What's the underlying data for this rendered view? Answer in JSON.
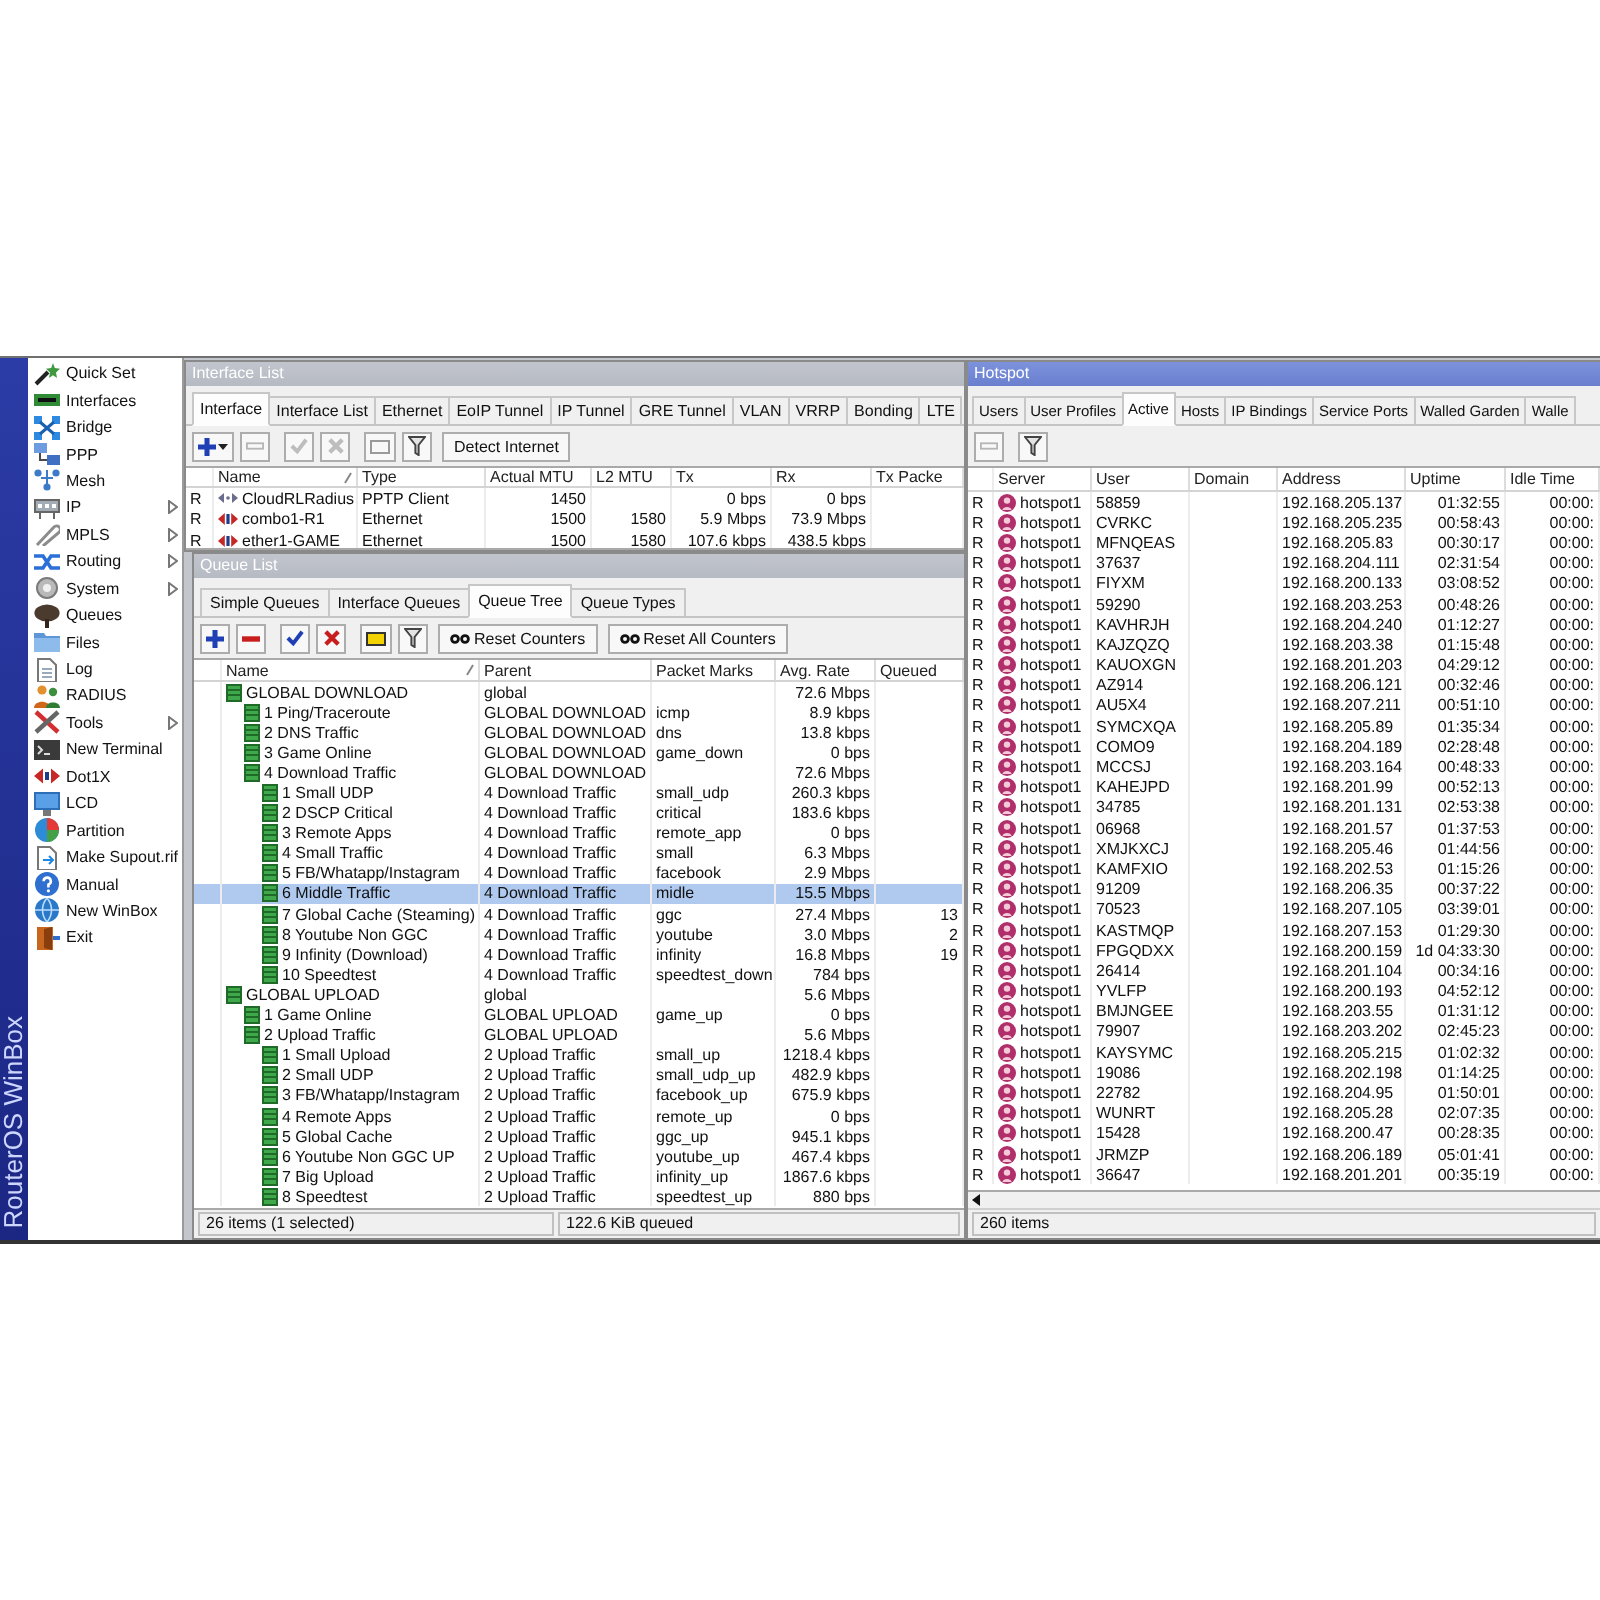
{
  "sidebar": {
    "brand": "RouterOS WinBox",
    "items": [
      {
        "label": "Quick Set",
        "submenu": false
      },
      {
        "label": "Interfaces",
        "submenu": false
      },
      {
        "label": "Bridge",
        "submenu": false
      },
      {
        "label": "PPP",
        "submenu": false
      },
      {
        "label": "Mesh",
        "submenu": false
      },
      {
        "label": "IP",
        "submenu": true
      },
      {
        "label": "MPLS",
        "submenu": true
      },
      {
        "label": "Routing",
        "submenu": true
      },
      {
        "label": "System",
        "submenu": true
      },
      {
        "label": "Queues",
        "submenu": false
      },
      {
        "label": "Files",
        "submenu": false
      },
      {
        "label": "Log",
        "submenu": false
      },
      {
        "label": "RADIUS",
        "submenu": false
      },
      {
        "label": "Tools",
        "submenu": true
      },
      {
        "label": "New Terminal",
        "submenu": false
      },
      {
        "label": "Dot1X",
        "submenu": false
      },
      {
        "label": "LCD",
        "submenu": false
      },
      {
        "label": "Partition",
        "submenu": false
      },
      {
        "label": "Make Supout.rif",
        "submenu": false
      },
      {
        "label": "Manual",
        "submenu": false
      },
      {
        "label": "New WinBox",
        "submenu": false
      },
      {
        "label": "Exit",
        "submenu": false
      }
    ]
  },
  "interface_list": {
    "title": "Interface List",
    "active": false,
    "tabs": [
      {
        "label": "Interface",
        "selected": true
      },
      {
        "label": "Interface List",
        "selected": false
      },
      {
        "label": "Ethernet",
        "selected": false
      },
      {
        "label": "EoIP Tunnel",
        "selected": false
      },
      {
        "label": "IP Tunnel",
        "selected": false
      },
      {
        "label": "GRE Tunnel",
        "selected": false
      },
      {
        "label": "VLAN",
        "selected": false
      },
      {
        "label": "VRRP",
        "selected": false
      },
      {
        "label": "Bonding",
        "selected": false
      },
      {
        "label": "LTE",
        "selected": false
      }
    ],
    "toolbar": [
      {
        "kind": "add",
        "dropdown": true,
        "disabled": false
      },
      {
        "kind": "remove",
        "disabled": true
      },
      {
        "kind": "enable",
        "disabled": true
      },
      {
        "kind": "disable",
        "disabled": true
      },
      {
        "kind": "comment",
        "disabled": true
      },
      {
        "kind": "filter",
        "disabled": false
      },
      {
        "kind": "text",
        "label": "Detect Internet"
      }
    ],
    "columns": [
      {
        "label": "Name",
        "sorted": true
      },
      {
        "label": "Type",
        "sorted": false
      },
      {
        "label": "Actual MTU",
        "sorted": false
      },
      {
        "label": "L2 MTU",
        "sorted": false
      },
      {
        "label": "Tx",
        "sorted": false
      },
      {
        "label": "Rx",
        "sorted": false
      },
      {
        "label": "Tx Packe",
        "sorted": false
      }
    ],
    "rows": [
      {
        "flag": "R",
        "kind": "tunnel",
        "name": "CloudRLRadius",
        "type": "PPTP Client",
        "actual_mtu": "1450",
        "tx": "0 bps",
        "rx": "0 bps"
      },
      {
        "flag": "R",
        "kind": "ethernet",
        "name": "combo1-R1",
        "type": "Ethernet",
        "actual_mtu": "1500",
        "l2_mtu": "1580",
        "tx": "5.9 Mbps",
        "rx": "73.9 Mbps"
      },
      {
        "flag": "R",
        "kind": "ethernet",
        "name": "ether1-GAME",
        "type": "Ethernet",
        "actual_mtu": "1500",
        "l2_mtu": "1580",
        "tx": "107.6 kbps",
        "rx": "438.5 kbps"
      }
    ]
  },
  "queue_list": {
    "title": "Queue List",
    "active": false,
    "tabs": [
      {
        "label": "Simple Queues",
        "selected": false
      },
      {
        "label": "Interface Queues",
        "selected": false
      },
      {
        "label": "Queue Tree",
        "selected": true
      },
      {
        "label": "Queue Types",
        "selected": false
      }
    ],
    "toolbar": [
      {
        "kind": "add",
        "dropdown": false,
        "disabled": false
      },
      {
        "kind": "remove",
        "disabled": false
      },
      {
        "kind": "enable",
        "disabled": false
      },
      {
        "kind": "disable",
        "disabled": false
      },
      {
        "kind": "comment",
        "disabled": false
      },
      {
        "kind": "filter",
        "disabled": false
      },
      {
        "kind": "reset",
        "label": "Reset Counters"
      },
      {
        "kind": "reset",
        "label": "Reset All Counters"
      }
    ],
    "columns": [
      {
        "label": "Name",
        "sorted": true
      },
      {
        "label": "Parent",
        "sorted": false
      },
      {
        "label": "Packet Marks",
        "sorted": false
      },
      {
        "label": "Avg. Rate",
        "sorted": false
      },
      {
        "label": "Queued",
        "sorted": false
      }
    ],
    "tree": [
      {
        "name": "GLOBAL DOWNLOAD",
        "parent": "global",
        "avg_rate": "72.6 Mbps",
        "selected": false,
        "children": [
          {
            "name": "1 Ping/Traceroute",
            "parent": "GLOBAL DOWNLOAD",
            "packet_marks": "icmp",
            "avg_rate": "8.9 kbps",
            "selected": false
          },
          {
            "name": "2 DNS Traffic",
            "parent": "GLOBAL DOWNLOAD",
            "packet_marks": "dns",
            "avg_rate": "13.8 kbps",
            "selected": false
          },
          {
            "name": "3 Game Online",
            "parent": "GLOBAL DOWNLOAD",
            "packet_marks": "game_down",
            "avg_rate": "0 bps",
            "selected": false
          },
          {
            "name": "4 Download Traffic",
            "parent": "GLOBAL DOWNLOAD",
            "avg_rate": "72.6 Mbps",
            "selected": false,
            "children": [
              {
                "name": "1 Small UDP",
                "parent": "4 Download Traffic",
                "packet_marks": "small_udp",
                "avg_rate": "260.3 kbps",
                "selected": false
              },
              {
                "name": "2 DSCP Critical",
                "parent": "4 Download Traffic",
                "packet_marks": "critical",
                "avg_rate": "183.6 kbps",
                "selected": false
              },
              {
                "name": "3 Remote Apps",
                "parent": "4 Download Traffic",
                "packet_marks": "remote_app",
                "avg_rate": "0 bps",
                "selected": false
              },
              {
                "name": "4 Small Traffic",
                "parent": "4 Download Traffic",
                "packet_marks": "small",
                "avg_rate": "6.3 Mbps",
                "selected": false
              },
              {
                "name": "5 FB/Whatapp/Instagram",
                "parent": "4 Download Traffic",
                "packet_marks": "facebook",
                "avg_rate": "2.9 Mbps",
                "selected": false
              },
              {
                "name": "6 Middle Traffic",
                "parent": "4 Download Traffic",
                "packet_marks": "midle",
                "avg_rate": "15.5 Mbps",
                "selected": true
              },
              {
                "name": "7 Global Cache (Steaming)",
                "parent": "4 Download Traffic",
                "packet_marks": "ggc",
                "avg_rate": "27.4 Mbps",
                "queued": "13",
                "selected": false
              },
              {
                "name": "8 Youtube Non GGC",
                "parent": "4 Download Traffic",
                "packet_marks": "youtube",
                "avg_rate": "3.0 Mbps",
                "queued": "2",
                "selected": false
              },
              {
                "name": "9 Infinity (Download)",
                "parent": "4 Download Traffic",
                "packet_marks": "infinity",
                "avg_rate": "16.8 Mbps",
                "queued": "19",
                "selected": false
              },
              {
                "name": "10 Speedtest",
                "parent": "4 Download Traffic",
                "packet_marks": "speedtest_down",
                "avg_rate": "784 bps",
                "selected": false
              }
            ]
          }
        ]
      },
      {
        "name": "GLOBAL UPLOAD",
        "parent": "global",
        "avg_rate": "5.6 Mbps",
        "selected": false,
        "children": [
          {
            "name": "1 Game Online",
            "parent": "GLOBAL UPLOAD",
            "packet_marks": "game_up",
            "avg_rate": "0 bps",
            "selected": false
          },
          {
            "name": "2 Upload Traffic",
            "parent": "GLOBAL UPLOAD",
            "avg_rate": "5.6 Mbps",
            "selected": false,
            "children": [
              {
                "name": "1 Small Upload",
                "parent": "2 Upload Traffic",
                "packet_marks": "small_up",
                "avg_rate": "1218.4 kbps",
                "selected": false
              },
              {
                "name": "2 Small UDP",
                "parent": "2 Upload Traffic",
                "packet_marks": "small_udp_up",
                "avg_rate": "482.9 kbps",
                "selected": false
              },
              {
                "name": "3 FB/Whatapp/Instagram",
                "parent": "2 Upload Traffic",
                "packet_marks": "facebook_up",
                "avg_rate": "675.9 kbps",
                "selected": false
              },
              {
                "name": "4 Remote Apps",
                "parent": "2 Upload Traffic",
                "packet_marks": "remote_up",
                "avg_rate": "0 bps",
                "selected": false
              },
              {
                "name": "5 Global Cache",
                "parent": "2 Upload Traffic",
                "packet_marks": "ggc_up",
                "avg_rate": "945.1 kbps",
                "selected": false
              },
              {
                "name": "6 Youtube Non GGC UP",
                "parent": "2 Upload Traffic",
                "packet_marks": "youtube_up",
                "avg_rate": "467.4 kbps",
                "selected": false
              },
              {
                "name": "7 Big Upload",
                "parent": "2 Upload Traffic",
                "packet_marks": "infinity_up",
                "avg_rate": "1867.6 kbps",
                "selected": false
              },
              {
                "name": "8 Speedtest",
                "parent": "2 Upload Traffic",
                "packet_marks": "speedtest_up",
                "avg_rate": "880 bps",
                "selected": false
              }
            ]
          }
        ]
      }
    ],
    "status": [
      "26 items (1 selected)",
      "122.6 KiB queued"
    ]
  },
  "hotspot": {
    "title": "Hotspot",
    "active": true,
    "tabs": [
      {
        "label": "Users",
        "selected": false
      },
      {
        "label": "User Profiles",
        "selected": false
      },
      {
        "label": "Active",
        "selected": true
      },
      {
        "label": "Hosts",
        "selected": false
      },
      {
        "label": "IP Bindings",
        "selected": false
      },
      {
        "label": "Service Ports",
        "selected": false
      },
      {
        "label": "Walled Garden",
        "selected": false
      },
      {
        "label": "Walle",
        "selected": false
      }
    ],
    "toolbar": [
      {
        "kind": "remove",
        "disabled": true
      },
      {
        "kind": "filter",
        "disabled": false
      }
    ],
    "columns": [
      {
        "label": "Server",
        "sorted": false
      },
      {
        "label": "User",
        "sorted": false
      },
      {
        "label": "Domain",
        "sorted": false
      },
      {
        "label": "Address",
        "sorted": false
      },
      {
        "label": "Uptime",
        "sorted": false
      },
      {
        "label": "Idle Time",
        "sorted": false
      }
    ],
    "rows": [
      {
        "flag": "R",
        "server": "hotspot1",
        "user": "58859",
        "address": "192.168.205.137",
        "uptime": "01:32:55",
        "idle_time": "00:00:"
      },
      {
        "flag": "R",
        "server": "hotspot1",
        "user": "CVRKC",
        "address": "192.168.205.235",
        "uptime": "00:58:43",
        "idle_time": "00:00:"
      },
      {
        "flag": "R",
        "server": "hotspot1",
        "user": "MFNQEAS",
        "address": "192.168.205.83",
        "uptime": "00:30:17",
        "idle_time": "00:00:"
      },
      {
        "flag": "R",
        "server": "hotspot1",
        "user": "37637",
        "address": "192.168.204.111",
        "uptime": "02:31:54",
        "idle_time": "00:00:"
      },
      {
        "flag": "R",
        "server": "hotspot1",
        "user": "FIYXM",
        "address": "192.168.200.133",
        "uptime": "03:08:52",
        "idle_time": "00:00:"
      },
      {
        "flag": "R",
        "server": "hotspot1",
        "user": "59290",
        "address": "192.168.203.253",
        "uptime": "00:48:26",
        "idle_time": "00:00:"
      },
      {
        "flag": "R",
        "server": "hotspot1",
        "user": "KAVHRJH",
        "address": "192.168.204.240",
        "uptime": "01:12:27",
        "idle_time": "00:00:"
      },
      {
        "flag": "R",
        "server": "hotspot1",
        "user": "KAJZQZQ",
        "address": "192.168.203.38",
        "uptime": "01:15:48",
        "idle_time": "00:00:"
      },
      {
        "flag": "R",
        "server": "hotspot1",
        "user": "KAUOXGN",
        "address": "192.168.201.203",
        "uptime": "04:29:12",
        "idle_time": "00:00:"
      },
      {
        "flag": "R",
        "server": "hotspot1",
        "user": "AZ914",
        "address": "192.168.206.121",
        "uptime": "00:32:46",
        "idle_time": "00:00:"
      },
      {
        "flag": "R",
        "server": "hotspot1",
        "user": "AU5X4",
        "address": "192.168.207.211",
        "uptime": "00:51:10",
        "idle_time": "00:00:"
      },
      {
        "flag": "R",
        "server": "hotspot1",
        "user": "SYMCXQA",
        "address": "192.168.205.89",
        "uptime": "01:35:34",
        "idle_time": "00:00:"
      },
      {
        "flag": "R",
        "server": "hotspot1",
        "user": "COMO9",
        "address": "192.168.204.189",
        "uptime": "02:28:48",
        "idle_time": "00:00:"
      },
      {
        "flag": "R",
        "server": "hotspot1",
        "user": "MCCSJ",
        "address": "192.168.203.164",
        "uptime": "00:48:33",
        "idle_time": "00:00:"
      },
      {
        "flag": "R",
        "server": "hotspot1",
        "user": "KAHEJPD",
        "address": "192.168.201.99",
        "uptime": "00:52:13",
        "idle_time": "00:00:"
      },
      {
        "flag": "R",
        "server": "hotspot1",
        "user": "34785",
        "address": "192.168.201.131",
        "uptime": "02:53:38",
        "idle_time": "00:00:"
      },
      {
        "flag": "R",
        "server": "hotspot1",
        "user": "06968",
        "address": "192.168.201.57",
        "uptime": "01:37:53",
        "idle_time": "00:00:"
      },
      {
        "flag": "R",
        "server": "hotspot1",
        "user": "XMJKXCJ",
        "address": "192.168.205.46",
        "uptime": "01:44:56",
        "idle_time": "00:00:"
      },
      {
        "flag": "R",
        "server": "hotspot1",
        "user": "KAMFXIO",
        "address": "192.168.202.53",
        "uptime": "01:15:26",
        "idle_time": "00:00:"
      },
      {
        "flag": "R",
        "server": "hotspot1",
        "user": "91209",
        "address": "192.168.206.35",
        "uptime": "00:37:22",
        "idle_time": "00:00:"
      },
      {
        "flag": "R",
        "server": "hotspot1",
        "user": "70523",
        "address": "192.168.207.105",
        "uptime": "03:39:01",
        "idle_time": "00:00:"
      },
      {
        "flag": "R",
        "server": "hotspot1",
        "user": "KASTMQP",
        "address": "192.168.207.153",
        "uptime": "01:29:30",
        "idle_time": "00:00:"
      },
      {
        "flag": "R",
        "server": "hotspot1",
        "user": "FPGQDXX",
        "address": "192.168.200.159",
        "uptime": "1d 04:33:30",
        "idle_time": "00:00:"
      },
      {
        "flag": "R",
        "server": "hotspot1",
        "user": "26414",
        "address": "192.168.201.104",
        "uptime": "00:34:16",
        "idle_time": "00:00:"
      },
      {
        "flag": "R",
        "server": "hotspot1",
        "user": "YVLFP",
        "address": "192.168.200.193",
        "uptime": "04:52:12",
        "idle_time": "00:00:"
      },
      {
        "flag": "R",
        "server": "hotspot1",
        "user": "BMJNGEE",
        "address": "192.168.203.55",
        "uptime": "01:31:12",
        "idle_time": "00:00:"
      },
      {
        "flag": "R",
        "server": "hotspot1",
        "user": "79907",
        "address": "192.168.203.202",
        "uptime": "02:45:23",
        "idle_time": "00:00:"
      },
      {
        "flag": "R",
        "server": "hotspot1",
        "user": "KAYSYMC",
        "address": "192.168.205.215",
        "uptime": "01:02:32",
        "idle_time": "00:00:"
      },
      {
        "flag": "R",
        "server": "hotspot1",
        "user": "19086",
        "address": "192.168.202.198",
        "uptime": "01:14:25",
        "idle_time": "00:00:"
      },
      {
        "flag": "R",
        "server": "hotspot1",
        "user": "22782",
        "address": "192.168.204.95",
        "uptime": "01:50:01",
        "idle_time": "00:00:"
      },
      {
        "flag": "R",
        "server": "hotspot1",
        "user": "WUNRT",
        "address": "192.168.205.28",
        "uptime": "02:07:35",
        "idle_time": "00:00:"
      },
      {
        "flag": "R",
        "server": "hotspot1",
        "user": "15428",
        "address": "192.168.200.47",
        "uptime": "00:28:35",
        "idle_time": "00:00:"
      },
      {
        "flag": "R",
        "server": "hotspot1",
        "user": "JRMZP",
        "address": "192.168.206.189",
        "uptime": "05:01:41",
        "idle_time": "00:00:"
      },
      {
        "flag": "R",
        "server": "hotspot1",
        "user": "36647",
        "address": "192.168.201.201",
        "uptime": "00:35:19",
        "idle_time": "00:00:"
      }
    ],
    "status": [
      "260 items"
    ]
  }
}
